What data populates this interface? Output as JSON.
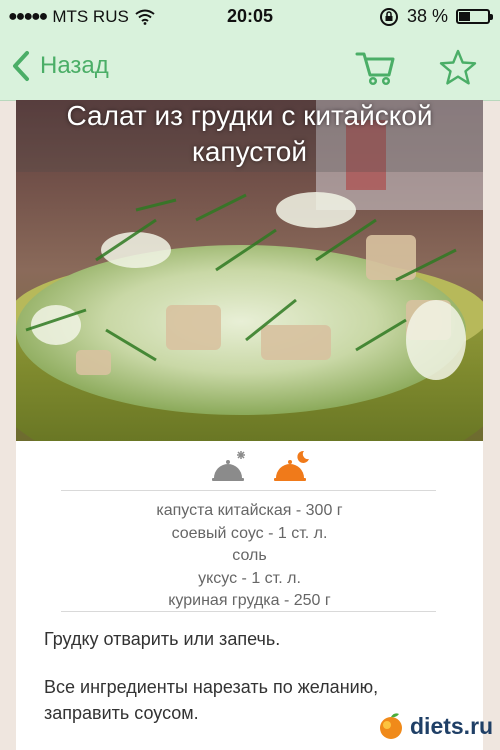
{
  "status": {
    "carrier": "MTS RUS",
    "time": "20:05",
    "battery": "38 %",
    "battery_level": 0.38
  },
  "nav": {
    "back_label": "Назад",
    "accent": "#4bae67",
    "icons": [
      "chevron-left-icon",
      "cart-icon",
      "star-icon"
    ]
  },
  "recipe": {
    "title_line1": "Салат из грудки с китайской",
    "title_line2": "капустой",
    "meal_icons": [
      "cloche-day-icon",
      "cloche-night-icon"
    ],
    "ingredients": [
      "капуста китайская - 300 г",
      "соевый соус - 1 ст. л.",
      "соль",
      "уксус - 1 ст. л.",
      "куриная грудка - 250 г"
    ],
    "steps": [
      "Грудку отварить или запечь.",
      "Все ингредиенты нарезать по желанию, заправить соусом."
    ]
  },
  "watermark": {
    "text": "diets.ru"
  }
}
